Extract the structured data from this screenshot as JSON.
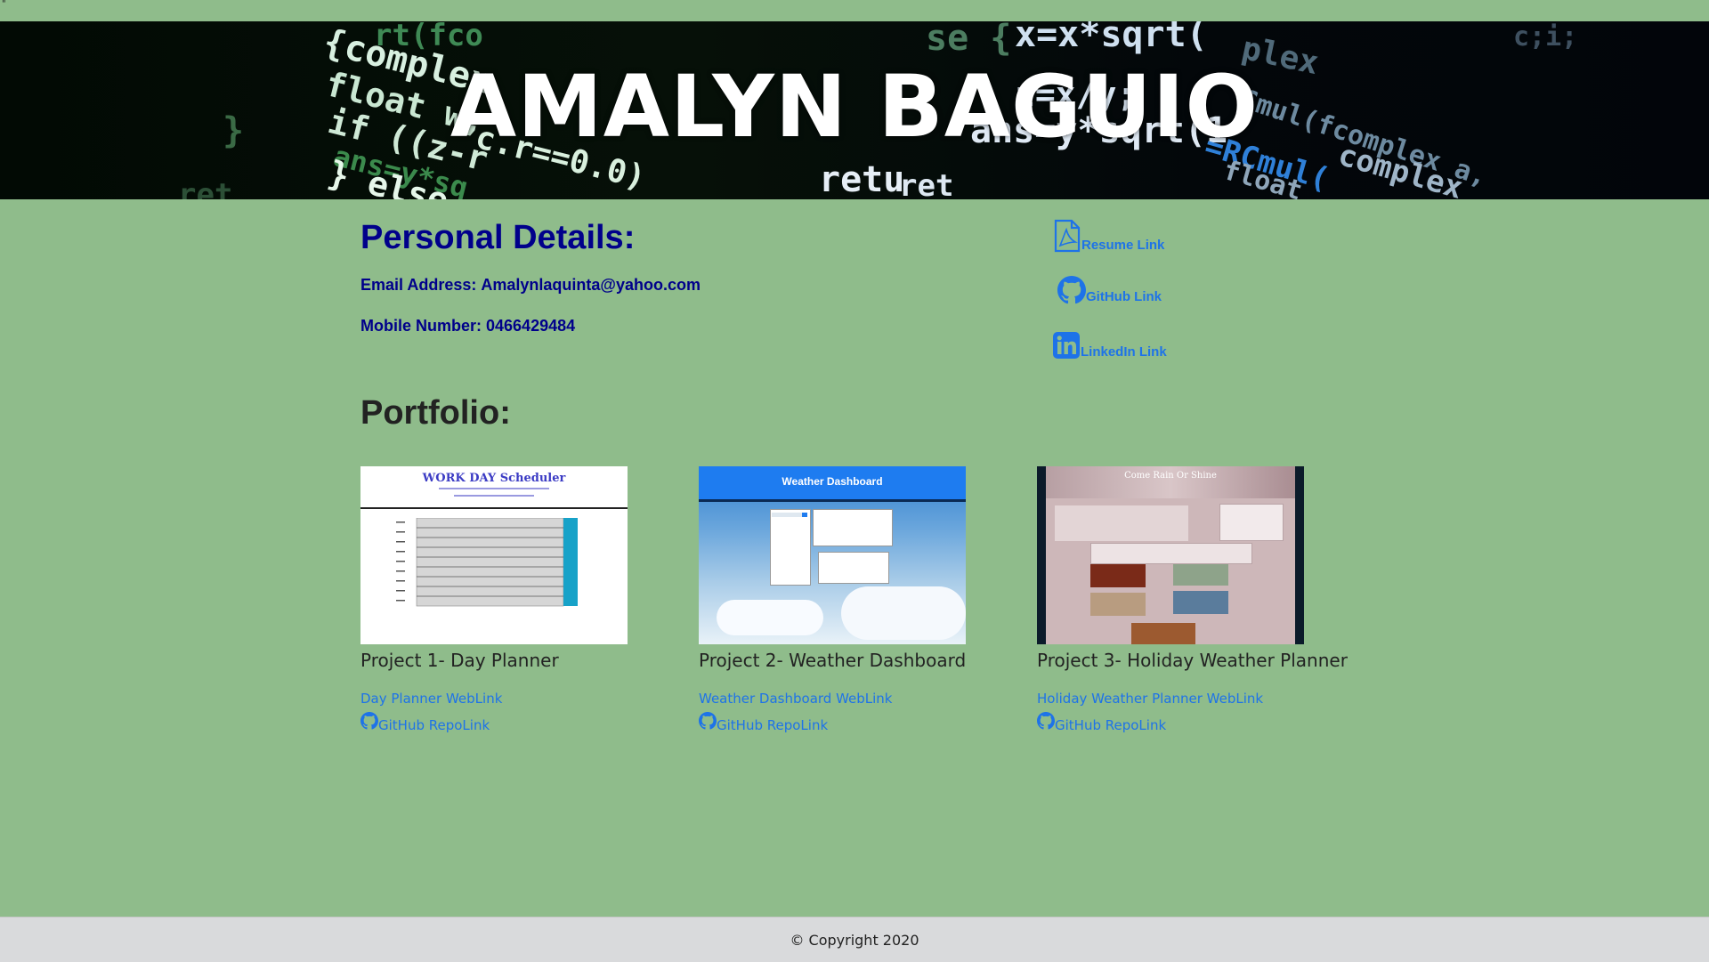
{
  "stray_mark": "\"",
  "banner": {
    "title": "AMALYN BAGUIO"
  },
  "personal": {
    "heading": "Personal Details:",
    "email_label": "Email Address:",
    "email_value": "Amalynlaquinta@yahoo.com",
    "mobile_label": "Mobile Number:",
    "mobile_value": "0466429484"
  },
  "side_links": {
    "resume": {
      "label": "Resume Link",
      "icon": "pdf-file-icon"
    },
    "github": {
      "label": "GitHub Link",
      "icon": "github-icon"
    },
    "linkedin": {
      "label": "LinkedIn Link",
      "icon": "linkedin-icon"
    }
  },
  "portfolio": {
    "heading": "Portfolio:",
    "projects": [
      {
        "title": "Project 1- Day Planner",
        "weblink": "Day Planner WebLink",
        "repolink": "GitHub RepoLink",
        "thumb_heading": "WORK DAY Scheduler"
      },
      {
        "title": "Project 2- Weather Dashboard",
        "weblink": "Weather Dashboard WebLink",
        "repolink": "GitHub RepoLink",
        "thumb_heading": "Weather Dashboard"
      },
      {
        "title": "Project 3- Holiday Weather Planner",
        "weblink": "Holiday Weather Planner WebLink",
        "repolink": "GitHub RepoLink",
        "thumb_heading": "Come Rain Or Shine"
      }
    ]
  },
  "footer": {
    "copyright": "© Copyright 2020"
  },
  "colors": {
    "page_background": "#8fbc8b",
    "heading_navy": "#00008b",
    "link_blue": "#1e73e8",
    "footer_background": "#d9dadc"
  }
}
